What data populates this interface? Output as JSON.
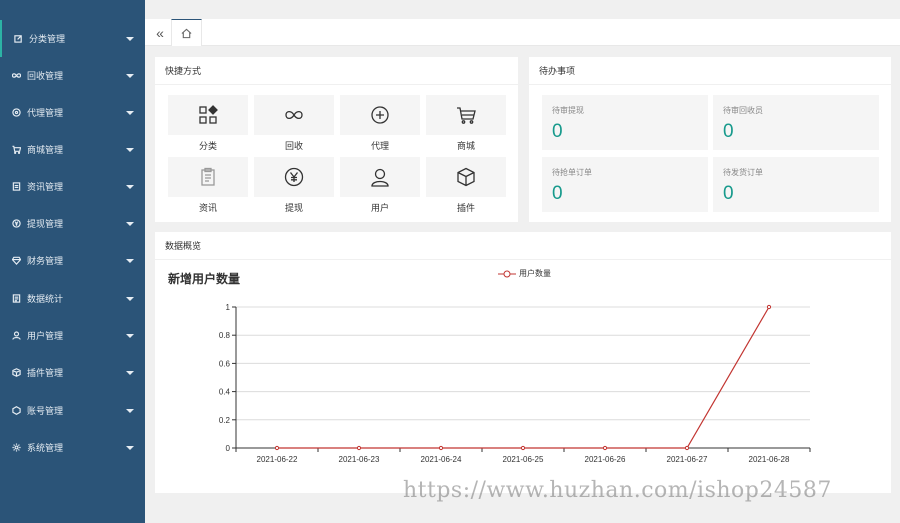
{
  "sidebar": {
    "items": [
      {
        "label": "分类管理",
        "icon": "category-edit-icon"
      },
      {
        "label": "回收管理",
        "icon": "infinity-icon"
      },
      {
        "label": "代理管理",
        "icon": "target-icon"
      },
      {
        "label": "商城管理",
        "icon": "cart-icon"
      },
      {
        "label": "资讯管理",
        "icon": "document-icon"
      },
      {
        "label": "提现管理",
        "icon": "yen-circle-icon"
      },
      {
        "label": "财务管理",
        "icon": "diamond-icon"
      },
      {
        "label": "数据统计",
        "icon": "report-icon"
      },
      {
        "label": "用户管理",
        "icon": "user-icon"
      },
      {
        "label": "插件管理",
        "icon": "cube-icon"
      },
      {
        "label": "账号管理",
        "icon": "hexagon-icon"
      },
      {
        "label": "系统管理",
        "icon": "gear-icon"
      }
    ]
  },
  "topbar": {
    "collapse_glyph": "«",
    "home_icon": "home-icon"
  },
  "quick": {
    "title": "快捷方式",
    "items": [
      {
        "label": "分类",
        "icon": "category-icon"
      },
      {
        "label": "回收",
        "icon": "infinity-icon"
      },
      {
        "label": "代理",
        "icon": "plus-circle-icon"
      },
      {
        "label": "商城",
        "icon": "cart-icon"
      },
      {
        "label": "资讯",
        "icon": "clipboard-icon"
      },
      {
        "label": "提现",
        "icon": "yen-circle-icon"
      },
      {
        "label": "用户",
        "icon": "user-icon"
      },
      {
        "label": "插件",
        "icon": "cube-icon"
      }
    ]
  },
  "todo": {
    "title": "待办事项",
    "items": [
      {
        "label": "待审提现",
        "value": "0"
      },
      {
        "label": "待审回收员",
        "value": "0"
      },
      {
        "label": "待抢单订单",
        "value": "0"
      },
      {
        "label": "待发货订单",
        "value": "0"
      }
    ]
  },
  "overview": {
    "title": "数据概览"
  },
  "chart_data": {
    "type": "line",
    "title": "新增用户数量",
    "x": [
      "2021-06-22",
      "2021-06-23",
      "2021-06-24",
      "2021-06-25",
      "2021-06-26",
      "2021-06-27",
      "2021-06-28"
    ],
    "series": [
      {
        "name": "用户数量",
        "values": [
          0,
          0,
          0,
          0,
          0,
          0,
          1
        ],
        "color": "#c23531"
      }
    ],
    "yticks": [
      "0",
      "0.2",
      "0.4",
      "0.6",
      "0.8",
      "1"
    ],
    "ylim": [
      0,
      1
    ],
    "grid": true,
    "legend": "top-center"
  },
  "watermark": "https://www.huzhan.com/ishop24587",
  "colors": {
    "sidebar": "#2b5478",
    "accent": "#179a8c",
    "series": "#c23531"
  }
}
